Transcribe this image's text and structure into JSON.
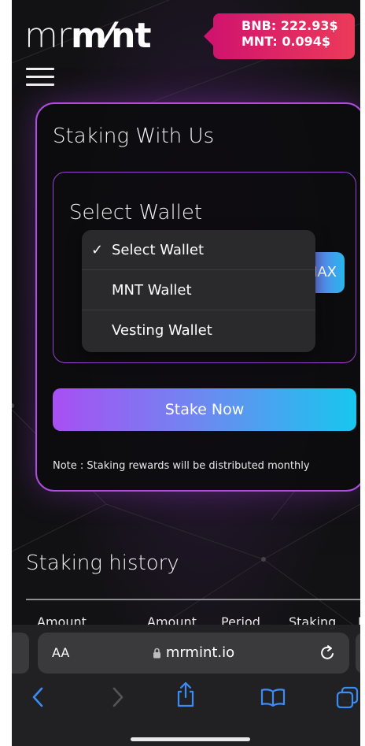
{
  "header": {
    "logo_light": "mr",
    "logo_bold": "m⁄nt",
    "price_bnb": "BNB: 222.93$",
    "price_mnt": "MNT: 0.094$"
  },
  "staking": {
    "title": "Staking With Us",
    "wallet_label": "Select Wallet",
    "max_label": "MAX",
    "stake_button": "Stake Now",
    "note": "Note : Staking rewards will be distributed monthly"
  },
  "dropdown": {
    "selected": "Select Wallet",
    "items": [
      {
        "label": "Select Wallet",
        "checked": true
      },
      {
        "label": "MNT Wallet",
        "checked": false
      },
      {
        "label": "Vesting Wallet",
        "checked": false
      }
    ],
    "check_glyph": "✓"
  },
  "history": {
    "title": "Staking history",
    "columns": [
      "Amount",
      "Amount",
      "Period",
      "Staking",
      "N"
    ]
  },
  "browser": {
    "text_size_label": "AA",
    "url": "mrmint.io",
    "icons": [
      "lock-icon",
      "reload-icon",
      "back-icon",
      "forward-icon",
      "share-icon",
      "bookmarks-icon",
      "tabs-icon"
    ]
  },
  "colors": {
    "accent_purple": "#b04ce0",
    "badge_pink": "#d0146e",
    "gradient_start": "#a84ff2",
    "gradient_end": "#17c7ee",
    "safari_blue": "#3b8cf5"
  }
}
